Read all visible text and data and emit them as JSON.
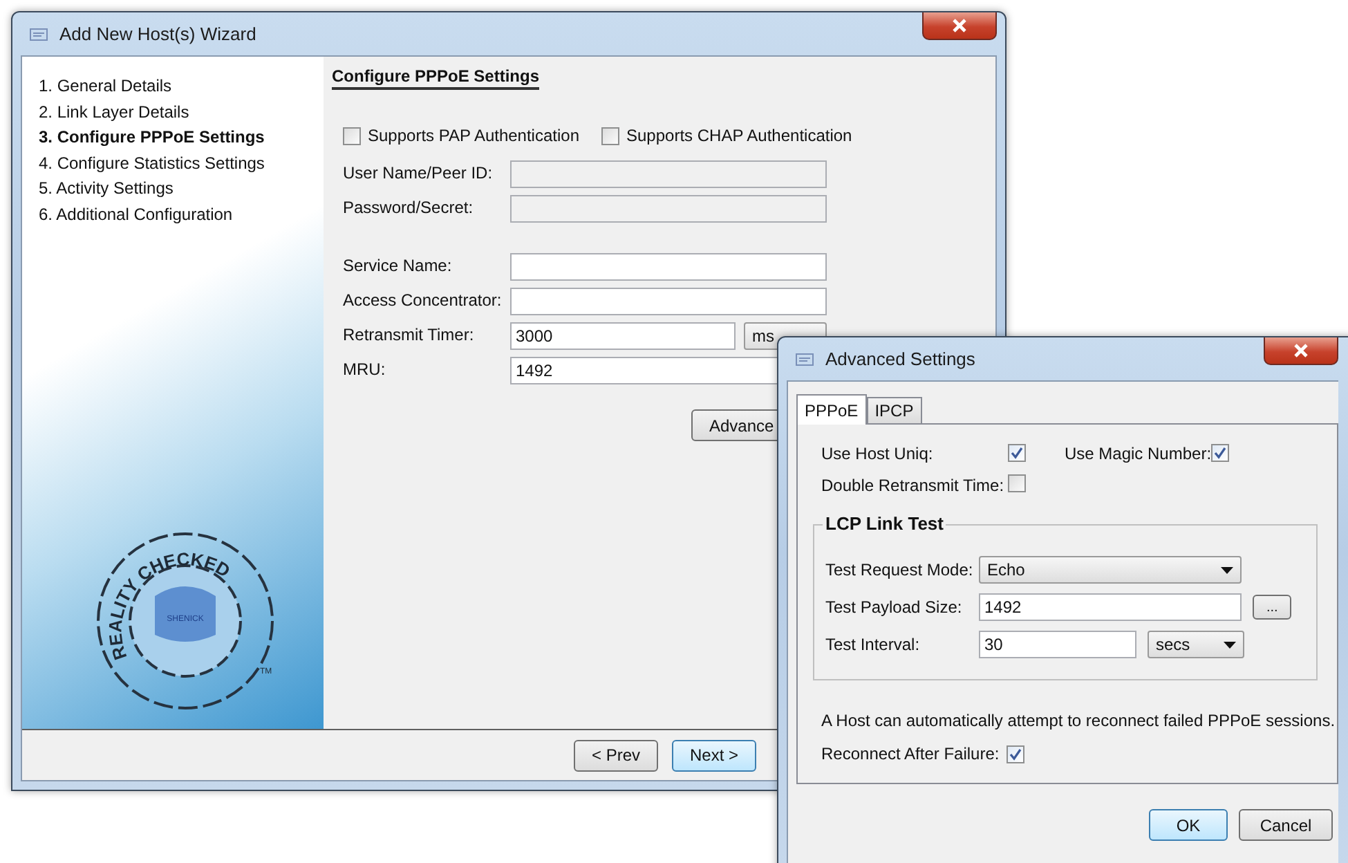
{
  "wizard": {
    "title": "Add New Host(s) Wizard",
    "steps": [
      {
        "label": "1. General Details",
        "selected": false
      },
      {
        "label": "2. Link Layer Details",
        "selected": false
      },
      {
        "label": "3. Configure PPPoE Settings",
        "selected": true
      },
      {
        "label": "4. Configure Statistics Settings",
        "selected": false
      },
      {
        "label": "5. Activity Settings",
        "selected": false
      },
      {
        "label": "6. Additional Configuration",
        "selected": false
      }
    ],
    "logo": {
      "ring_text": "REALITY  CHECKED",
      "center_text": "SHENICK",
      "mark": "TM"
    },
    "section_title": "Configure PPPoE Settings",
    "auth": [
      {
        "label": "Supports PAP Authentication",
        "checked": false
      },
      {
        "label": "Supports CHAP Authentication",
        "checked": false
      }
    ],
    "credentials": [
      {
        "label": "User Name/Peer ID:",
        "disabled": true
      },
      {
        "label": "Password/Secret:",
        "disabled": true
      }
    ],
    "fields": [
      {
        "label": "Service Name:",
        "disabled": false
      },
      {
        "label": "Access Concentrator:",
        "disabled": false
      },
      {
        "label": "Retransmit Timer:",
        "value": "3000",
        "unit": "ms",
        "disabled": false
      },
      {
        "label": "MRU:",
        "value": "1492",
        "disabled": false
      }
    ],
    "advanced_button": "Advance",
    "buttons": [
      {
        "label": "< Prev",
        "default": false
      },
      {
        "label": "Next >",
        "default": true
      }
    ]
  },
  "dialog": {
    "title": "Advanced Settings",
    "tabs": [
      {
        "label": "PPPoE",
        "selected": true
      },
      {
        "label": "IPCP",
        "selected": false
      }
    ],
    "options": [
      {
        "label": "Use Host Uniq:",
        "checked": true
      },
      {
        "label": "Use Magic Number:",
        "checked": true
      },
      {
        "label": "Double Retransmit Time:",
        "checked": false
      }
    ],
    "group": {
      "title": "LCP Link Test",
      "rows": [
        {
          "label": "Test Request Mode:",
          "kind": "select",
          "value": "Echo"
        },
        {
          "label": "Test Payload Size:",
          "kind": "input",
          "value": "1492",
          "button": "..."
        },
        {
          "label": "Test Interval:",
          "kind": "input",
          "value": "30",
          "unit": "secs"
        }
      ]
    },
    "note": "A Host can automatically attempt to reconnect failed PPPoE sessions.",
    "reconnect": {
      "label": "Reconnect After Failure:",
      "checked": true
    },
    "buttons": [
      {
        "label": "OK",
        "default": true
      },
      {
        "label": "Cancel",
        "default": false
      }
    ]
  }
}
